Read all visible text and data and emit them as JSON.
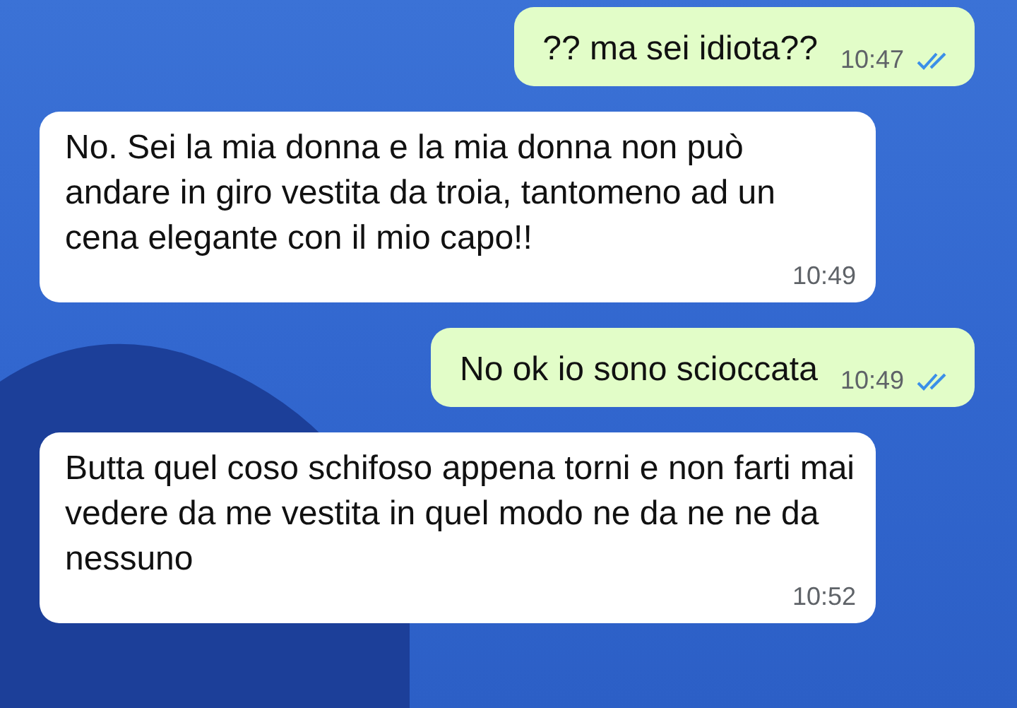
{
  "messages": [
    {
      "kind": "outgoing",
      "text": "?? ma sei idiota??",
      "time": "10:47",
      "read": true
    },
    {
      "kind": "incoming",
      "text": "No. Sei la mia donna e la mia donna non può andare in giro vestita da troia, tantomeno ad un cena elegante con il mio capo!!",
      "time": "10:49"
    },
    {
      "kind": "outgoing",
      "text": "No ok io sono scioccata",
      "time": "10:49",
      "read": true
    },
    {
      "kind": "incoming",
      "text": "Butta quel coso schifoso appena torni e non farti mai vedere da me vestita in quel modo ne da ne ne da nessuno",
      "time": "10:52"
    }
  ]
}
